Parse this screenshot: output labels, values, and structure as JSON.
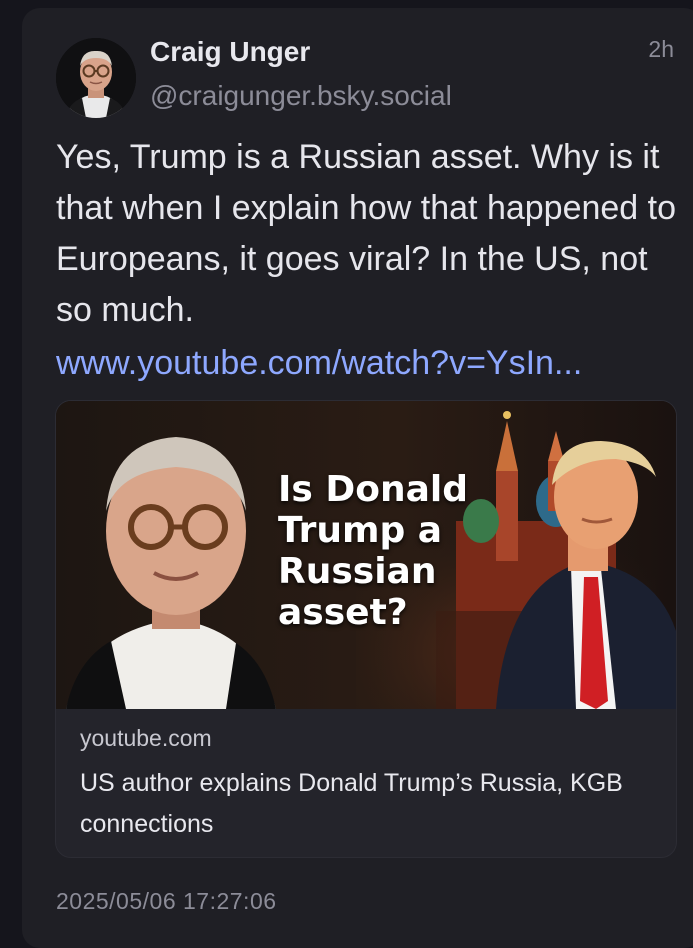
{
  "post": {
    "author": {
      "name": "Craig Unger",
      "handle": "@craigunger.bsky.social"
    },
    "time_ago": "2h",
    "text": "Yes, Trump is a Russian asset. Why is it that when I explain how that happened to Europeans, it goes viral? In the US, not so much.",
    "link_text": "www.youtube.com/watch?v=YsIn...",
    "embed": {
      "thumbnail_headline": "Is Donald Trump a Russian asset?",
      "domain": "youtube.com",
      "title": "US author explains Donald Trump’s Russia, KGB connections"
    },
    "timestamp": "2025/05/06 17:27:06"
  },
  "colors": {
    "background": "#15151c",
    "card": "#1f1f25",
    "link": "#8ea8ff",
    "muted_text": "#8c8c98",
    "primary_text": "#e6e6ec"
  }
}
